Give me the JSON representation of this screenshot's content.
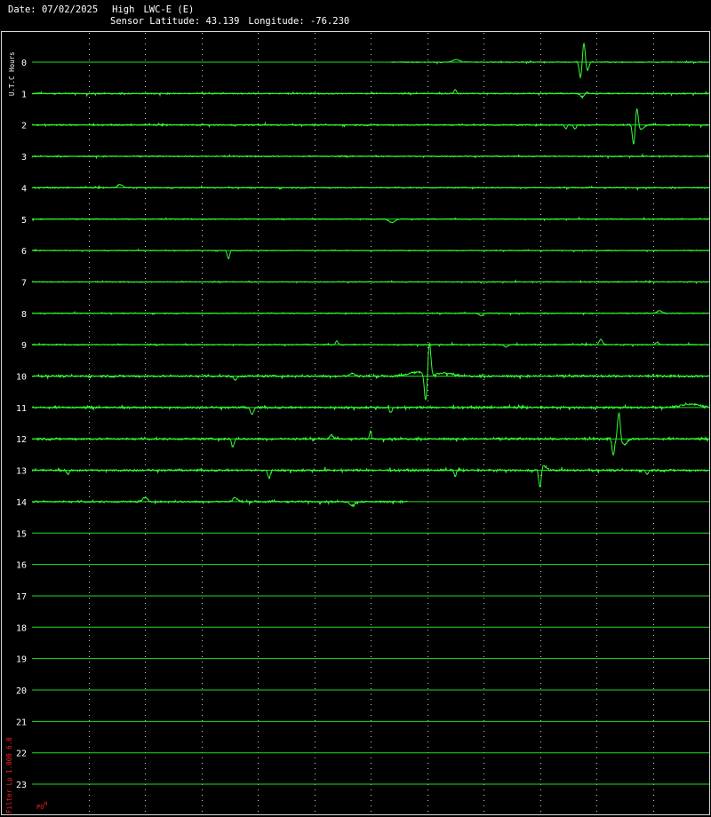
{
  "header": {
    "date_label": "Date:",
    "date": "07/02/2025",
    "gain": "High",
    "station": "LWC-E (E)",
    "latitude_label": "Sensor Latitude:",
    "latitude": "43.139",
    "longitude_label": "Longitude:",
    "longitude": "-76.230"
  },
  "side": {
    "utc_label": "U.T.C Hours",
    "filter_label": "Filter  Lp 1.000 6.0",
    "corner_main": "PO",
    "corner_sup": "H"
  },
  "colors": {
    "background": "#000000",
    "trace": "#33ff33",
    "baseline": "#22dd22",
    "grid": "#d0d0d0",
    "hour_label": "#ffffff",
    "filter_text": "#ff2020"
  },
  "chart_data": {
    "type": "line",
    "x_range_minutes": [
      0,
      60
    ],
    "grid_minutes": [
      5,
      10,
      15,
      20,
      25,
      30,
      35,
      40,
      45,
      50,
      55
    ],
    "hours": [
      0,
      1,
      2,
      3,
      4,
      5,
      6,
      7,
      8,
      9,
      10,
      11,
      12,
      13,
      14,
      15,
      16,
      17,
      18,
      19,
      20,
      21,
      22,
      23
    ],
    "rows": [
      {
        "hour": 0,
        "start_min": 31.8,
        "end_min": 60,
        "noise": 0.5,
        "events": [
          {
            "min": 37.6,
            "amp": 2.0,
            "w": 0.4
          },
          {
            "min": 48.6,
            "amp": -11,
            "w": 0.22
          },
          {
            "min": 48.9,
            "amp": 14,
            "w": 0.22
          },
          {
            "min": 49.2,
            "amp": -6,
            "w": 0.25
          }
        ]
      },
      {
        "hour": 1,
        "start_min": 0,
        "end_min": 60,
        "noise": 0.7,
        "events": [
          {
            "min": 37.5,
            "amp": 3,
            "w": 0.15
          },
          {
            "min": 48.8,
            "amp": -4,
            "w": 0.25
          },
          {
            "min": 49.0,
            "amp": 2,
            "w": 0.3
          }
        ]
      },
      {
        "hour": 2,
        "start_min": 0,
        "end_min": 60,
        "noise": 0.7,
        "events": [
          {
            "min": 47.3,
            "amp": -3,
            "w": 0.12
          },
          {
            "min": 48.1,
            "amp": -3,
            "w": 0.15
          },
          {
            "min": 53.3,
            "amp": -14,
            "w": 0.2
          },
          {
            "min": 53.6,
            "amp": 12,
            "w": 0.2
          },
          {
            "min": 54.0,
            "amp": -3,
            "w": 0.3
          }
        ]
      },
      {
        "hour": 3,
        "start_min": 0,
        "end_min": 60,
        "noise": 0.6,
        "events": []
      },
      {
        "hour": 4,
        "start_min": 0,
        "end_min": 60,
        "noise": 0.6,
        "events": [
          {
            "min": 7.8,
            "amp": 2.5,
            "w": 0.3
          }
        ]
      },
      {
        "hour": 5,
        "start_min": 0,
        "end_min": 60,
        "noise": 0.5,
        "events": [
          {
            "min": 31.9,
            "amp": -2.5,
            "w": 0.35
          }
        ]
      },
      {
        "hour": 6,
        "start_min": 0,
        "end_min": 60,
        "noise": 0.4,
        "events": [
          {
            "min": 17.4,
            "amp": -6,
            "w": 0.2
          }
        ]
      },
      {
        "hour": 7,
        "start_min": 0,
        "end_min": 60,
        "noise": 0.5,
        "events": []
      },
      {
        "hour": 8,
        "start_min": 0,
        "end_min": 60,
        "noise": 0.5,
        "events": [
          {
            "min": 39.8,
            "amp": -2,
            "w": 0.2
          },
          {
            "min": 55.6,
            "amp": 2,
            "w": 0.3
          }
        ]
      },
      {
        "hour": 9,
        "start_min": 0,
        "end_min": 60,
        "noise": 0.6,
        "events": [
          {
            "min": 27.0,
            "amp": 3,
            "w": 0.15
          },
          {
            "min": 42.0,
            "amp": -2,
            "w": 0.2
          },
          {
            "min": 50.4,
            "amp": 4,
            "w": 0.2
          },
          {
            "min": 55.4,
            "amp": 2,
            "w": 0.2
          }
        ]
      },
      {
        "hour": 10,
        "start_min": 0,
        "end_min": 60,
        "noise": 1.1,
        "events": [
          {
            "min": 18.0,
            "amp": -3,
            "w": 0.2
          },
          {
            "min": 28.4,
            "amp": 2,
            "w": 0.3
          },
          {
            "min": 34.0,
            "amp": 3,
            "w": 0.9
          },
          {
            "min": 34.9,
            "amp": -20,
            "w": 0.25
          },
          {
            "min": 35.2,
            "amp": 24,
            "w": 0.25
          },
          {
            "min": 36.6,
            "amp": 2.5,
            "w": 1.0
          }
        ]
      },
      {
        "hour": 11,
        "start_min": 0,
        "end_min": 60,
        "noise": 1.1,
        "events": [
          {
            "min": 19.5,
            "amp": -5,
            "w": 0.2
          },
          {
            "min": 31.8,
            "amp": -4,
            "w": 0.15
          },
          {
            "min": 58.4,
            "amp": 2.5,
            "w": 1.2
          }
        ]
      },
      {
        "hour": 12,
        "start_min": 0,
        "end_min": 60,
        "noise": 1.1,
        "events": [
          {
            "min": 17.8,
            "amp": -6,
            "w": 0.2
          },
          {
            "min": 26.5,
            "amp": 3,
            "w": 0.2
          },
          {
            "min": 30.0,
            "amp": 6,
            "w": 0.15
          },
          {
            "min": 51.5,
            "amp": -12,
            "w": 0.2
          },
          {
            "min": 52.0,
            "amp": 20,
            "w": 0.22
          },
          {
            "min": 52.5,
            "amp": -4,
            "w": 0.3
          }
        ]
      },
      {
        "hour": 13,
        "start_min": 0,
        "end_min": 60,
        "noise": 1.1,
        "events": [
          {
            "min": 3.2,
            "amp": -3,
            "w": 0.15
          },
          {
            "min": 21.0,
            "amp": -6,
            "w": 0.2
          },
          {
            "min": 37.5,
            "amp": -6,
            "w": 0.15
          },
          {
            "min": 45.0,
            "amp": -13,
            "w": 0.2
          },
          {
            "min": 45.4,
            "amp": 3,
            "w": 0.3
          },
          {
            "min": 54.5,
            "amp": -3,
            "w": 0.15
          }
        ]
      },
      {
        "hour": 14,
        "start_min": 0,
        "end_min": 33.3,
        "noise": 1.0,
        "events": [
          {
            "min": 10.0,
            "amp": 3,
            "w": 0.3
          },
          {
            "min": 18.0,
            "amp": 3,
            "w": 0.3
          },
          {
            "min": 28.4,
            "amp": -3,
            "w": 0.3
          }
        ]
      },
      {
        "hour": 15,
        "start_min": 0,
        "end_min": 0,
        "noise": 0,
        "events": []
      },
      {
        "hour": 16,
        "start_min": 0,
        "end_min": 0,
        "noise": 0,
        "events": []
      },
      {
        "hour": 17,
        "start_min": 0,
        "end_min": 0,
        "noise": 0,
        "events": []
      },
      {
        "hour": 18,
        "start_min": 0,
        "end_min": 0,
        "noise": 0,
        "events": []
      },
      {
        "hour": 19,
        "start_min": 0,
        "end_min": 0,
        "noise": 0,
        "events": []
      },
      {
        "hour": 20,
        "start_min": 0,
        "end_min": 0,
        "noise": 0,
        "events": []
      },
      {
        "hour": 21,
        "start_min": 0,
        "end_min": 0,
        "noise": 0,
        "events": []
      },
      {
        "hour": 22,
        "start_min": 0,
        "end_min": 0,
        "noise": 0,
        "events": []
      },
      {
        "hour": 23,
        "start_min": 0,
        "end_min": 0,
        "noise": 0,
        "events": []
      }
    ]
  }
}
